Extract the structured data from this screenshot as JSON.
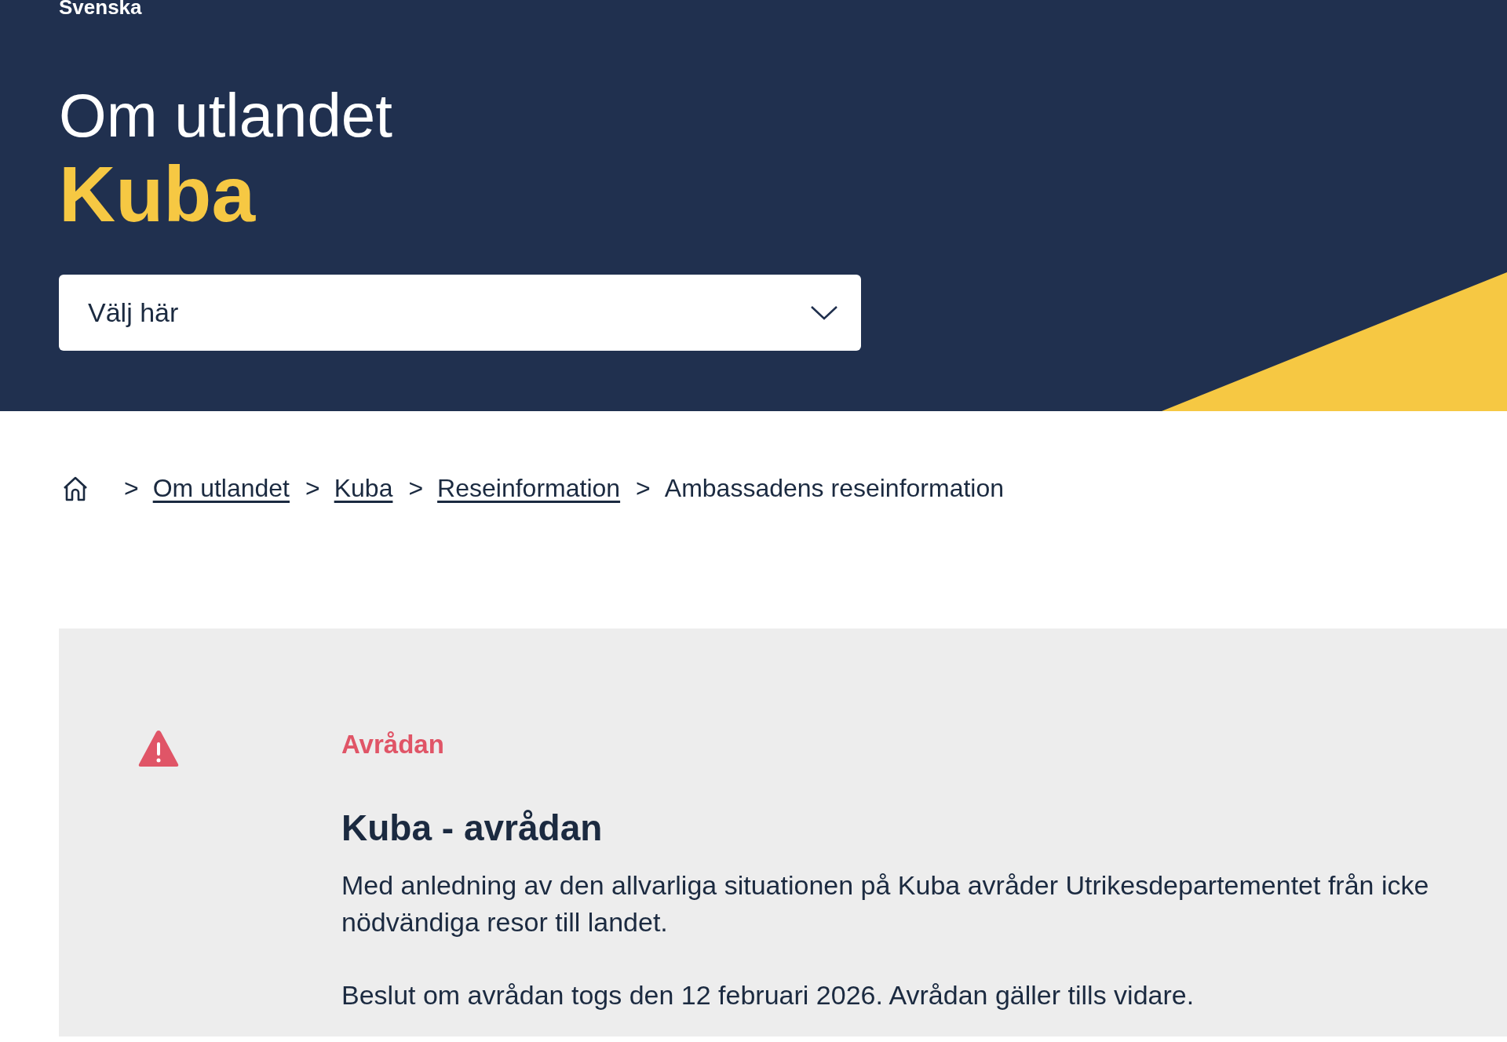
{
  "language": "Svenska",
  "header": {
    "title": "Om utlandet",
    "country": "Kuba",
    "select": {
      "placeholder": "Välj här"
    }
  },
  "breadcrumb": {
    "separator": ">",
    "items": [
      {
        "label": "Om utlandet",
        "link": true
      },
      {
        "label": "Kuba",
        "link": true
      },
      {
        "label": "Reseinformation",
        "link": true
      },
      {
        "label": "Ambassadens reseinformation",
        "link": false
      }
    ]
  },
  "notice": {
    "kind": "warning",
    "label": "Avrådan",
    "heading": "Kuba - avrådan",
    "paragraphs": [
      "Med anledning av den allvarliga situationen på Kuba avråder Utrikesdepartementet från icke nödvändiga resor till landet.",
      "Beslut om avrådan togs den 12 februari 2026. Avrådan gäller tills vidare."
    ]
  }
}
